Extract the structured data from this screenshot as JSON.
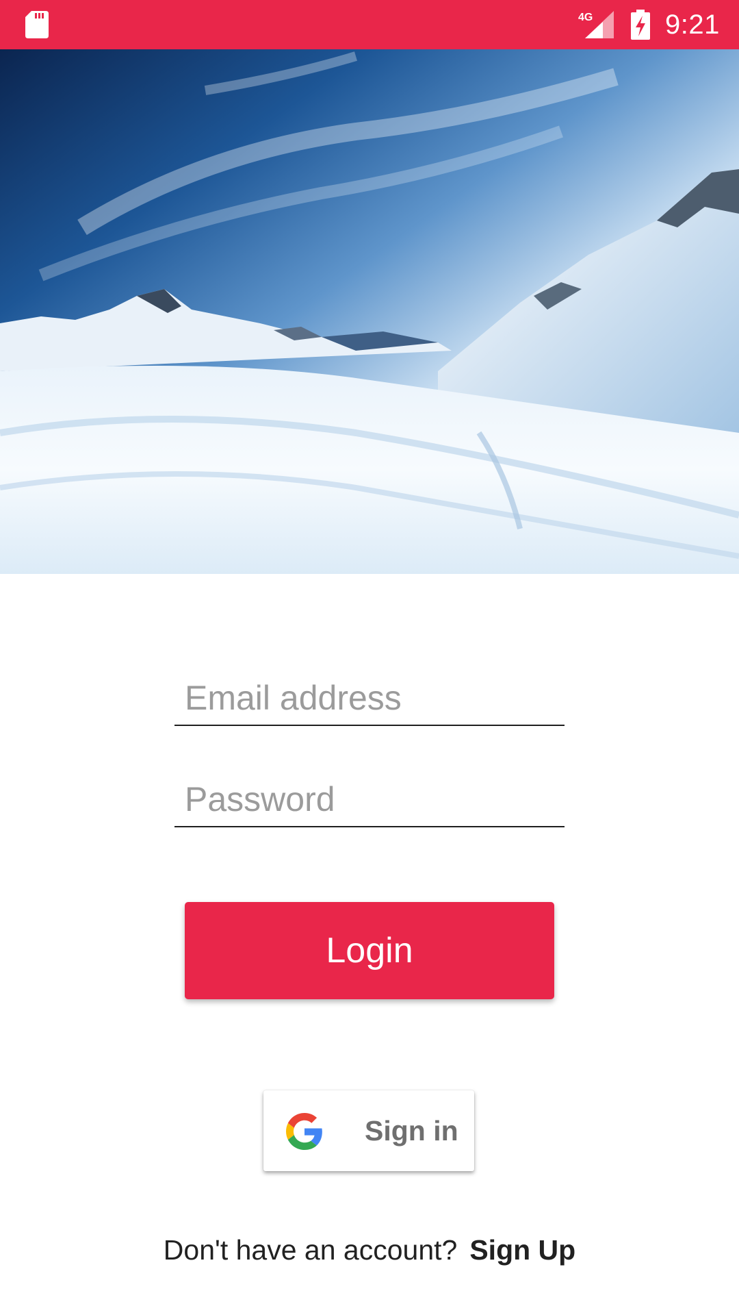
{
  "status_bar": {
    "background_color": "#e9264a",
    "time": "9:21",
    "network_label": "4G",
    "icons": [
      "sd-card-icon",
      "signal-4g-icon",
      "battery-charging-icon"
    ]
  },
  "hero": {
    "image": "snowy-mountains-landscape",
    "close_icon": "close-icon"
  },
  "form": {
    "email": {
      "value": "",
      "placeholder": "Email address"
    },
    "password": {
      "value": "",
      "placeholder": "Password"
    },
    "login_label": "Login",
    "accent_color": "#e9264a"
  },
  "google": {
    "label": "Sign in",
    "icon": "google-logo-icon"
  },
  "signup": {
    "prompt": "Don't have an account?",
    "link": "Sign Up"
  }
}
